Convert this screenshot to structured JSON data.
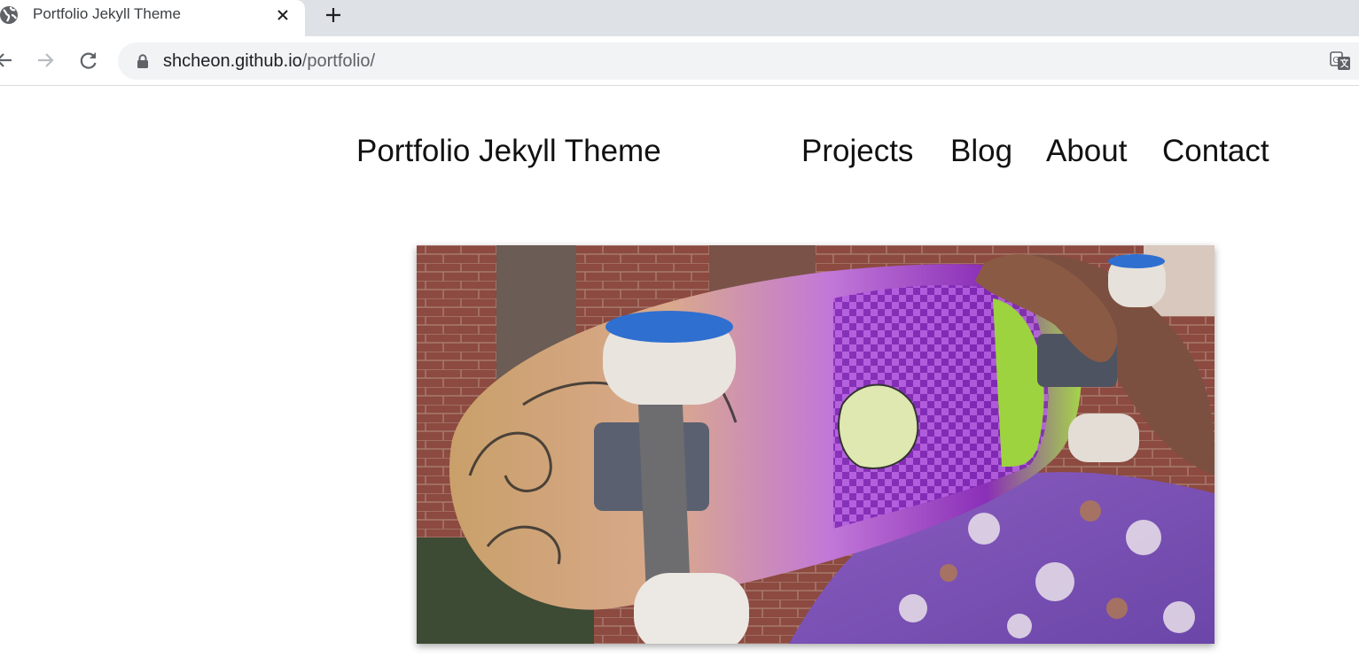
{
  "browser": {
    "tab": {
      "title": "Portfolio Jekyll Theme",
      "favicon": "globe-icon",
      "close_icon": "close-icon"
    },
    "new_tab_icon": "plus-icon",
    "toolbar": {
      "back_icon": "arrow-left-icon",
      "forward_icon": "arrow-right-icon",
      "reload_icon": "reload-icon"
    },
    "omnibox": {
      "security_icon": "lock-icon",
      "url_host": "shcheon.github.io",
      "url_path": "/portfolio/",
      "translate_icon": "translate-icon"
    }
  },
  "site": {
    "title": "Portfolio Jekyll Theme",
    "nav": [
      "Projects",
      "Blog",
      "About",
      "Contact"
    ]
  },
  "hero_image": {
    "description_icon": "skateboard-photo",
    "colors": {
      "brick": "#8a4a3f",
      "deck_purple": "#9a4fd0",
      "deck_lime": "#b8d54a",
      "wheel": "#e8e4df"
    }
  }
}
